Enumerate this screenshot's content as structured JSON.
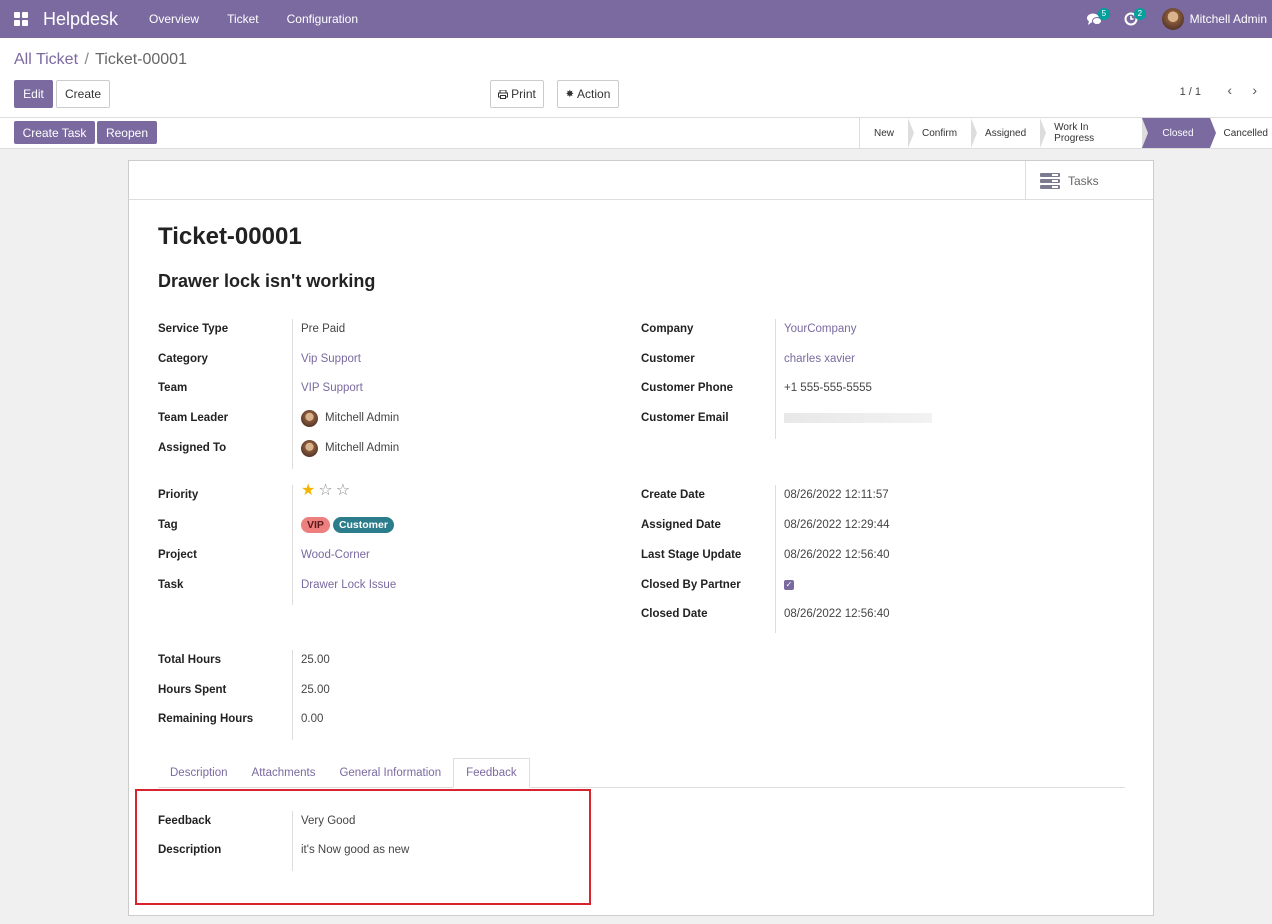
{
  "app": {
    "brand": "Helpdesk",
    "menu": [
      "Overview",
      "Ticket",
      "Configuration"
    ],
    "messages_count": "5",
    "activities_count": "2",
    "user_name": "Mitchell Admin"
  },
  "breadcrumb": {
    "parent": "All Ticket",
    "separator": "/",
    "current": "Ticket-00001"
  },
  "buttons": {
    "edit": "Edit",
    "create": "Create",
    "print": "Print",
    "action": "Action",
    "create_task": "Create Task",
    "reopen": "Reopen"
  },
  "pager": {
    "text": "1 / 1"
  },
  "stages": [
    {
      "label": "New",
      "active": false
    },
    {
      "label": "Confirm",
      "active": false
    },
    {
      "label": "Assigned",
      "active": false
    },
    {
      "label": "Work In Progress",
      "active": false
    },
    {
      "label": "Closed",
      "active": true
    },
    {
      "label": "Cancelled",
      "active": false
    }
  ],
  "smart_button": {
    "label": "Tasks"
  },
  "ticket": {
    "number": "Ticket-00001",
    "subject": "Drawer lock isn't working"
  },
  "left_group_1": [
    {
      "label": "Service Type",
      "value": "Pre Paid"
    },
    {
      "label": "Category",
      "value": "Vip Support"
    },
    {
      "label": "Team",
      "value": "VIP Support"
    },
    {
      "label": "Team Leader",
      "value": "Mitchell Admin"
    },
    {
      "label": "Assigned To",
      "value": "Mitchell Admin"
    }
  ],
  "right_group_1": [
    {
      "label": "Company",
      "value": "YourCompany"
    },
    {
      "label": "Customer",
      "value": "charles xavier"
    },
    {
      "label": "Customer Phone",
      "value": "+1 555-555-5555"
    },
    {
      "label": "Customer Email",
      "value": ""
    }
  ],
  "left_group_2": {
    "priority_label": "Priority",
    "priority_stars": 1,
    "priority_max": 3,
    "tag_label": "Tag",
    "tags": [
      "VIP",
      "Customer"
    ],
    "project_label": "Project",
    "project": "Wood-Corner",
    "task_label": "Task",
    "task": "Drawer Lock Issue"
  },
  "right_group_2": [
    {
      "label": "Create Date",
      "value": "08/26/2022 12:11:57"
    },
    {
      "label": "Assigned Date",
      "value": "08/26/2022 12:29:44"
    },
    {
      "label": "Last Stage Update",
      "value": "08/26/2022 12:56:40"
    },
    {
      "label": "Closed By Partner",
      "value": "",
      "checked": true
    },
    {
      "label": "Closed Date",
      "value": "08/26/2022 12:56:40"
    }
  ],
  "hours": [
    {
      "label": "Total Hours",
      "value": "25.00"
    },
    {
      "label": "Hours Spent",
      "value": "25.00"
    },
    {
      "label": "Remaining Hours",
      "value": "0.00"
    }
  ],
  "tabs": [
    {
      "label": "Description",
      "active": false
    },
    {
      "label": "Attachments",
      "active": false
    },
    {
      "label": "General Information",
      "active": false
    },
    {
      "label": "Feedback",
      "active": true
    }
  ],
  "feedback": [
    {
      "label": "Feedback",
      "value": "Very Good"
    },
    {
      "label": "Description",
      "value": "it's Now good as new"
    }
  ],
  "colors": {
    "brand": "#7a6aa0",
    "badge": "#00a09d",
    "tag_vip": "#ee7f7f",
    "tag_customer": "#2b7d8c",
    "highlight": "#d9232e"
  }
}
